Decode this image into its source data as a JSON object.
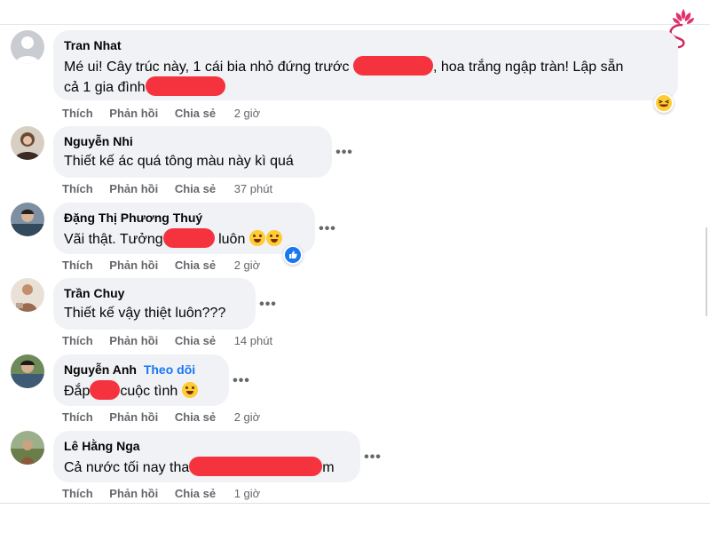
{
  "action_labels": {
    "like": "Thích",
    "reply": "Phản hồi",
    "share": "Chia sẻ"
  },
  "more_label": "•••",
  "comments": [
    {
      "author": "Tran Nhat",
      "line1_a": "Mé ui! Cây trúc này, 1 cái bia nhỏ đứng trước ",
      "line1_b": ", hoa trắng ngập tràn! Lập sẵn",
      "line2_a": "cả 1 gia đình",
      "time": "2 giờ",
      "reaction_icon": "laughing-emoji-icon"
    },
    {
      "author": "Nguyễn Nhi",
      "text": "Thiết kế ác quá tông màu này kì quá",
      "time": "37 phút"
    },
    {
      "author": "Đặng Thị Phương Thuý",
      "text_a": "Vãi thật. Tưởng",
      "text_b": " luôn",
      "time": "2 giờ",
      "reaction_icon": "like-reaction-icon"
    },
    {
      "author": "Trần Chuy",
      "text": "Thiết kế vậy thiệt luôn???",
      "time": "14 phút"
    },
    {
      "author": "Nguyễn Anh",
      "follow": "Theo dõi",
      "text_a": "Đắp",
      "text_b": "cuộc tình",
      "time": "2 giờ"
    },
    {
      "author": "Lê Hằng Nga",
      "text_a": "Cả nước tối nay tha",
      "text_b": "m",
      "time": "1 giờ"
    }
  ],
  "colors": {
    "bubble": "#f0f2f5",
    "redaction": "#f5333f",
    "action_text": "#65676b",
    "follow_link": "#1877f2",
    "logo_accent": "#e0316e"
  }
}
